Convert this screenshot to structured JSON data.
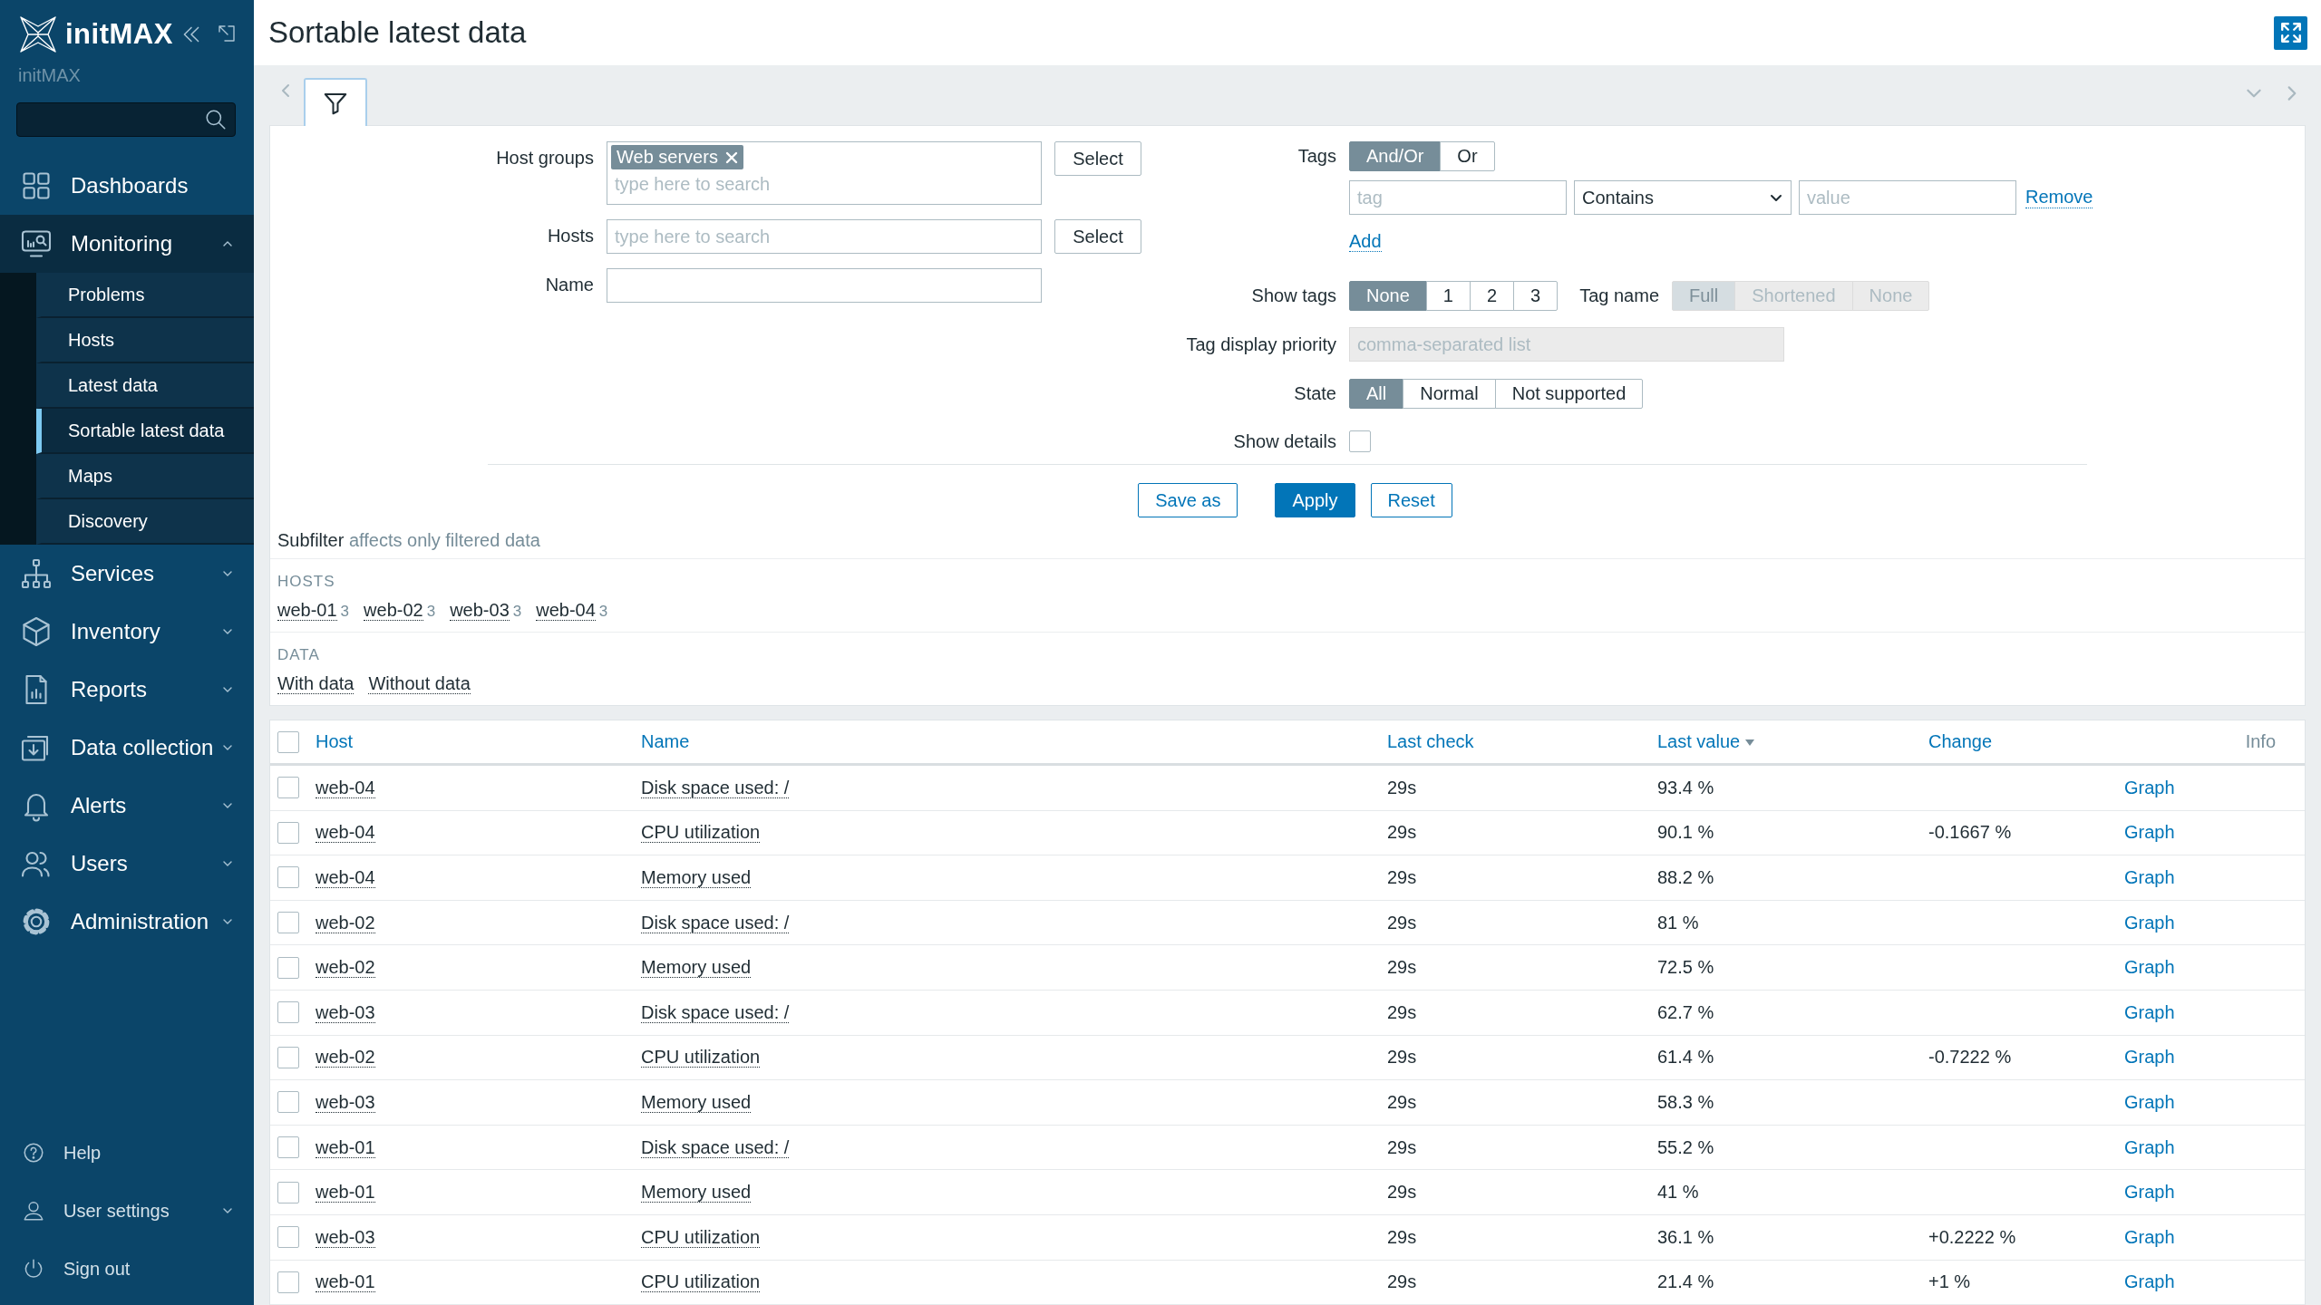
{
  "sidebar": {
    "brand": "initMAX",
    "server": "initMAX",
    "menu": [
      {
        "label": "Dashboards"
      },
      {
        "label": "Monitoring",
        "expanded": true,
        "children": [
          {
            "label": "Problems",
            "selected": false
          },
          {
            "label": "Hosts",
            "selected": false
          },
          {
            "label": "Latest data",
            "selected": false
          },
          {
            "label": "Sortable latest data",
            "selected": true
          },
          {
            "label": "Maps",
            "selected": false
          },
          {
            "label": "Discovery",
            "selected": false
          }
        ]
      },
      {
        "label": "Services",
        "expanded": false
      },
      {
        "label": "Inventory",
        "expanded": false
      },
      {
        "label": "Reports",
        "expanded": false
      },
      {
        "label": "Data collection",
        "expanded": false
      },
      {
        "label": "Alerts",
        "expanded": false
      },
      {
        "label": "Users",
        "expanded": false
      },
      {
        "label": "Administration",
        "expanded": false
      }
    ],
    "footer": [
      {
        "label": "Help"
      },
      {
        "label": "User settings",
        "expanded": false
      },
      {
        "label": "Sign out"
      }
    ]
  },
  "header": {
    "title": "Sortable latest data"
  },
  "filter": {
    "host_groups": {
      "label": "Host groups",
      "tags": [
        "Web servers"
      ],
      "placeholder": "type here to search",
      "button": "Select"
    },
    "hosts": {
      "label": "Hosts",
      "placeholder": "type here to search",
      "button": "Select"
    },
    "name": {
      "label": "Name"
    },
    "tags": {
      "label": "Tags",
      "operators": [
        {
          "label": "And/Or",
          "selected": true
        },
        {
          "label": "Or",
          "selected": false
        }
      ],
      "rows": [
        {
          "tag_placeholder": "tag",
          "operator": "Contains",
          "value_placeholder": "value",
          "remove": "Remove"
        }
      ],
      "add": "Add"
    },
    "show_tags": {
      "label": "Show tags",
      "options": [
        {
          "label": "None",
          "selected": true
        },
        {
          "label": "1",
          "selected": false
        },
        {
          "label": "2",
          "selected": false
        },
        {
          "label": "3",
          "selected": false
        }
      ]
    },
    "tag_name": {
      "label": "Tag name",
      "disabled": true,
      "options": [
        {
          "label": "Full",
          "selected": true
        },
        {
          "label": "Shortened",
          "selected": false
        },
        {
          "label": "None",
          "selected": false
        }
      ]
    },
    "tag_display_priority": {
      "label": "Tag display priority",
      "placeholder": "comma-separated list",
      "disabled": true
    },
    "state": {
      "label": "State",
      "options": [
        {
          "label": "All",
          "selected": true
        },
        {
          "label": "Normal",
          "selected": false
        },
        {
          "label": "Not supported",
          "selected": false
        }
      ]
    },
    "show_details": {
      "label": "Show details",
      "checked": false
    },
    "buttons": [
      {
        "label": "Save as",
        "kind": "secondary"
      },
      {
        "label": "Apply",
        "kind": "primary"
      },
      {
        "label": "Reset",
        "kind": "secondary"
      }
    ]
  },
  "subfilter": {
    "title": "Subfilter",
    "note": "affects only filtered data",
    "groups": [
      {
        "title": "HOSTS",
        "items": [
          {
            "label": "web-01",
            "count": "3"
          },
          {
            "label": "web-02",
            "count": "3"
          },
          {
            "label": "web-03",
            "count": "3"
          },
          {
            "label": "web-04",
            "count": "3"
          }
        ]
      },
      {
        "title": "DATA",
        "items": [
          {
            "label": "With data"
          },
          {
            "label": "Without data"
          }
        ]
      }
    ]
  },
  "table": {
    "select_all": {
      "checked": false
    },
    "columns": [
      {
        "label": "Host",
        "sortable": true,
        "sorted": false
      },
      {
        "label": "Name",
        "sortable": true,
        "sorted": false
      },
      {
        "label": "Last check",
        "sortable": true,
        "sorted": false
      },
      {
        "label": "Last value",
        "sortable": true,
        "sorted": true
      },
      {
        "label": "Change",
        "sortable": true,
        "sorted": false
      },
      {
        "label": "Info",
        "sortable": false,
        "sorted": false
      }
    ],
    "rows": [
      {
        "checked": false,
        "host": "web-04",
        "name": "Disk space used: /",
        "last_check": "29s",
        "last_value": "93.4 %",
        "action": "Graph"
      },
      {
        "checked": false,
        "host": "web-04",
        "name": "CPU utilization",
        "last_check": "29s",
        "last_value": "90.1 %",
        "change": "-0.1667 %",
        "action": "Graph"
      },
      {
        "checked": false,
        "host": "web-04",
        "name": "Memory used",
        "last_check": "29s",
        "last_value": "88.2 %",
        "action": "Graph"
      },
      {
        "checked": false,
        "host": "web-02",
        "name": "Disk space used: /",
        "last_check": "29s",
        "last_value": "81 %",
        "action": "Graph"
      },
      {
        "checked": false,
        "host": "web-02",
        "name": "Memory used",
        "last_check": "29s",
        "last_value": "72.5 %",
        "action": "Graph"
      },
      {
        "checked": false,
        "host": "web-03",
        "name": "Disk space used: /",
        "last_check": "29s",
        "last_value": "62.7 %",
        "action": "Graph"
      },
      {
        "checked": false,
        "host": "web-02",
        "name": "CPU utilization",
        "last_check": "29s",
        "last_value": "61.4 %",
        "change": "-0.7222 %",
        "action": "Graph"
      },
      {
        "checked": false,
        "host": "web-03",
        "name": "Memory used",
        "last_check": "29s",
        "last_value": "58.3 %",
        "action": "Graph"
      },
      {
        "checked": false,
        "host": "web-01",
        "name": "Disk space used: /",
        "last_check": "29s",
        "last_value": "55.2 %",
        "action": "Graph"
      },
      {
        "checked": false,
        "host": "web-01",
        "name": "Memory used",
        "last_check": "29s",
        "last_value": "41 %",
        "action": "Graph"
      },
      {
        "checked": false,
        "host": "web-03",
        "name": "CPU utilization",
        "last_check": "29s",
        "last_value": "36.1 %",
        "change": "+0.2222 %",
        "action": "Graph"
      },
      {
        "checked": false,
        "host": "web-01",
        "name": "CPU utilization",
        "last_check": "29s",
        "last_value": "21.4 %",
        "change": "+1 %",
        "action": "Graph"
      }
    ]
  }
}
